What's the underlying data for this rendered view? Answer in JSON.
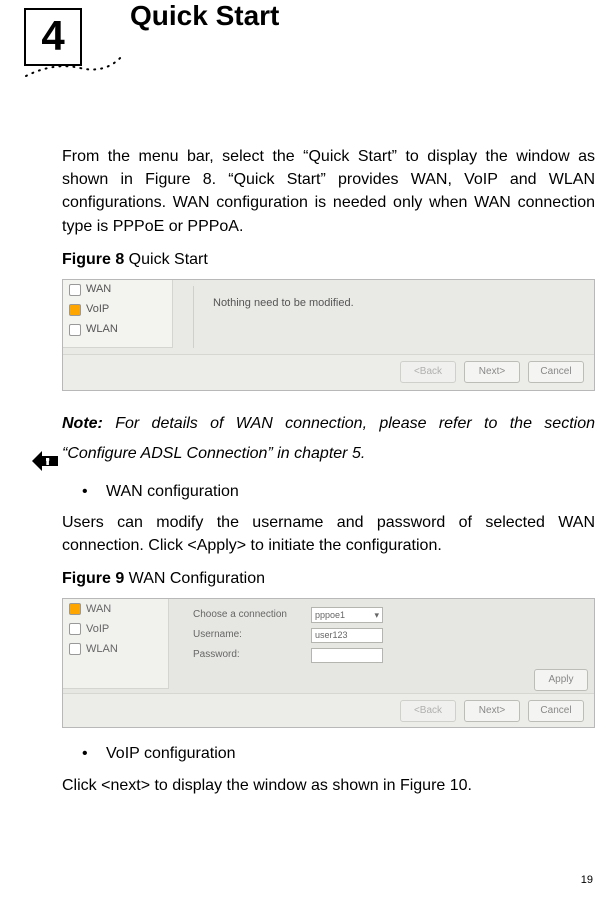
{
  "chapter": {
    "number": "4",
    "title": "Quick Start"
  },
  "p_intro": "From the menu bar, select the “Quick Start” to display the window as shown in Figure 8. “Quick Start” provides WAN, VoIP and WLAN configurations. WAN configuration is needed only when WAN connection type is PPPoE or PPPoA.",
  "fig8": {
    "label_bold": "Figure 8",
    "label_rest": " Quick Start",
    "side_items": [
      "WAN",
      "VoIP",
      "WLAN"
    ],
    "message": "Nothing need to be modified.",
    "btn_back": "<Back",
    "btn_next": "Next>",
    "btn_cancel": "Cancel"
  },
  "note": {
    "prefix_bold": "Note:",
    "rest": " For details of WAN connection, please refer to the section “Configure ADSL Connection” in chapter 5."
  },
  "bullet1": "WAN configuration",
  "p_wan": "Users can modify the username and password of selected WAN connection. Click <Apply> to initiate the configuration.",
  "fig9": {
    "label_bold": "Figure 9",
    "label_rest": " WAN Configuration",
    "side_items": [
      "WAN",
      "VoIP",
      "WLAN"
    ],
    "form": {
      "choose_label": "Choose a connection",
      "choose_value": "pppoe1",
      "user_label": "Username:",
      "user_value": "user123",
      "pass_label": "Password:",
      "pass_value": ""
    },
    "btn_apply": "Apply",
    "btn_back": "<Back",
    "btn_next": "Next>",
    "btn_cancel": "Cancel"
  },
  "bullet2": "VoIP configuration",
  "p_voip": "Click <next> to display the window as shown in Figure 10.",
  "page_number": "19"
}
